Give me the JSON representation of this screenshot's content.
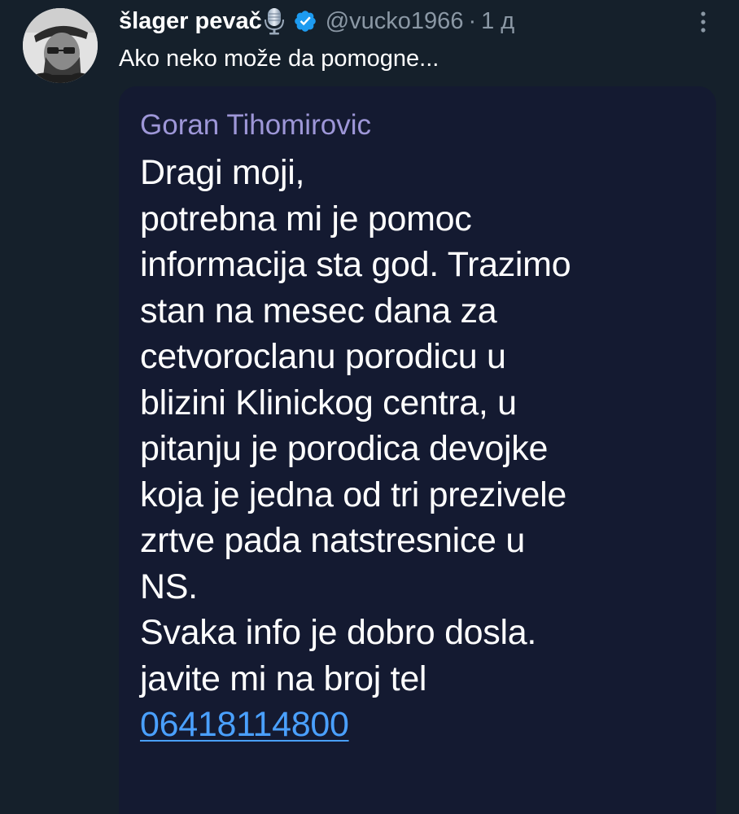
{
  "tweet": {
    "display_name": "šlager pevač",
    "name_emoji_icon": "microphone-icon",
    "verified_icon": "verified-badge-icon",
    "handle": "@vucko1966",
    "separator": "·",
    "time": "1 д",
    "more_icon": "more-vertical-icon",
    "text": "Ako neko može da pomogne..."
  },
  "media": {
    "sender": "Goran Tihomirovic",
    "lines": [
      "Dragi moji,",
      "potrebna mi je pomoc",
      "informacija sta god. Trazimo",
      "stan na mesec dana za",
      "cetvoroclanu porodicu u",
      "blizini Klinickog centra, u",
      "pitanju je porodica devojke",
      "koja je jedna od tri prezivele",
      "zrtve pada natstresnice u",
      "NS.",
      "Svaka info je dobro dosla.",
      "javite mi na broj tel"
    ],
    "phone": "06418114800"
  },
  "colors": {
    "background": "#15202b",
    "text_primary": "#ffffff",
    "text_secondary": "#8b98a5",
    "verified": "#1d9bf0",
    "media_bg": "#141a31",
    "sender": "#9e97d8",
    "link": "#4aa0ff"
  }
}
